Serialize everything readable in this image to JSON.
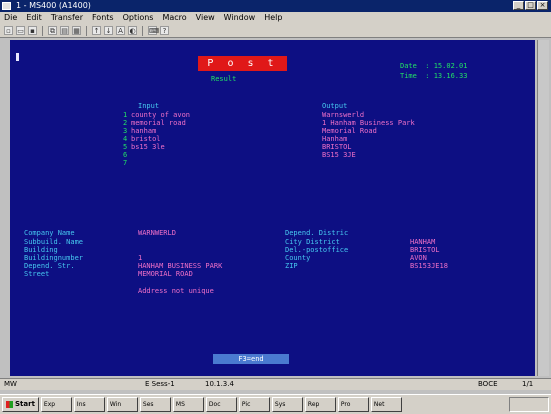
{
  "window": {
    "title": "1 - MS400 (A1400)"
  },
  "menu": [
    "Die",
    "Edit",
    "Transfer",
    "Fonts",
    "Options",
    "Macro",
    "View",
    "Window",
    "Help"
  ],
  "toolbar": {
    "icons": [
      "new-icon",
      "open-icon",
      "save-icon",
      "copy-icon",
      "paste-icon",
      "print-icon",
      "send-icon",
      "receive-icon",
      "font-icon",
      "color-icon",
      "keyboard-icon",
      "help-icon"
    ]
  },
  "screen": {
    "post_label": "P o s t",
    "result_label": "Result",
    "date_label": "Date  : 15.02.01",
    "time_label": "Time  : 13.16.33",
    "input_header": "Input",
    "output_header": "Output",
    "input_lines": [
      {
        "n": "1",
        "v": "county of avon"
      },
      {
        "n": "2",
        "v": "memorial road"
      },
      {
        "n": "3",
        "v": "hanham"
      },
      {
        "n": "4",
        "v": "bristol"
      },
      {
        "n": "5",
        "v": "bs15 3le"
      },
      {
        "n": "6",
        "v": ""
      },
      {
        "n": "7",
        "v": ""
      }
    ],
    "output_lines": [
      "Warnswerld",
      "1 Hanham Business Park",
      "Memorial Road",
      "Hanham",
      "BRISTOL",
      "BS15 3JE"
    ],
    "left_fields": [
      {
        "label": "Company Name",
        "value": "WARNWERLD"
      },
      {
        "label": "Subbuild. Name",
        "value": ""
      },
      {
        "label": "Building",
        "value": ""
      },
      {
        "label": "Buildingnumber",
        "value": "1"
      },
      {
        "label": "Depend. Str.",
        "value": "HANHAM BUSINESS PARK"
      },
      {
        "label": "Street",
        "value": "MEMORIAL ROAD"
      }
    ],
    "right_fields": [
      {
        "label": "Depend. Distric",
        "value": ""
      },
      {
        "label": "City District",
        "value": "HANHAM"
      },
      {
        "label": "Del.-postoffice",
        "value": "BRISTOL"
      },
      {
        "label": "County",
        "value": "AVON"
      },
      {
        "label": "ZIP",
        "value": "BS153JE18"
      }
    ],
    "message": "Address not unique",
    "key_label": "F3=end"
  },
  "status": {
    "left": "MW",
    "session": "E Sess-1",
    "address": "10.1.3.4",
    "mode": "BOCE",
    "page": "1/1"
  },
  "taskbar": {
    "start_label": "Start",
    "buttons": [
      "Exp",
      "Ins",
      "Win",
      "Ses",
      "MS",
      "Doc",
      "Pic",
      "Sys",
      "Rep",
      "Pro",
      "Net"
    ]
  },
  "colors": {
    "screen_bg": "#0d0f83",
    "green": "#22e066",
    "cyan": "#46c8f0",
    "pink": "#f070c8",
    "red": "#e01818"
  }
}
